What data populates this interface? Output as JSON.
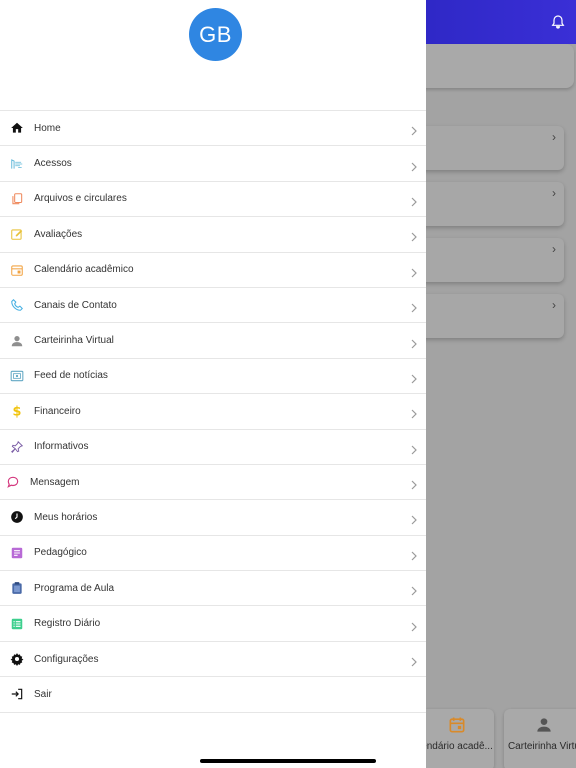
{
  "drawer": {
    "avatar_initials": "GB",
    "avatar_color": "#2f86e2",
    "items": [
      {
        "label": "Home",
        "icon": "home-icon",
        "color": "#111111"
      },
      {
        "label": "Acessos",
        "icon": "access-icon",
        "color": "#5db6d8"
      },
      {
        "label": "Arquivos e circulares",
        "icon": "files-icon",
        "color": "#ef8a5e"
      },
      {
        "label": "Avaliações",
        "icon": "edit-icon",
        "color": "#e8c23a"
      },
      {
        "label": "Calendário acadêmico",
        "icon": "calendar-icon",
        "color": "#f2a444"
      },
      {
        "label": "Canais de Contato",
        "icon": "phone-icon",
        "color": "#47b0e2"
      },
      {
        "label": "Carteirinha Virtual",
        "icon": "person-icon",
        "color": "#8f8f8f"
      },
      {
        "label": "Feed de notícias",
        "icon": "news-icon",
        "color": "#62a8c4"
      },
      {
        "label": "Financeiro",
        "icon": "dollar-icon",
        "color": "#f1c40f"
      },
      {
        "label": "Informativos",
        "icon": "pin-icon",
        "color": "#7b5ea6"
      },
      {
        "label": "Mensagem",
        "icon": "chat-icon",
        "color": "#d4387e"
      },
      {
        "label": "Meus horários",
        "icon": "clock-icon",
        "color": "#111111"
      },
      {
        "label": "Pedagógico",
        "icon": "document-icon",
        "color": "#b86ad6"
      },
      {
        "label": "Programa de Aula",
        "icon": "clipboard-icon",
        "color": "#4a6aa8"
      },
      {
        "label": "Registro Diário",
        "icon": "list-icon",
        "color": "#3ecf8e"
      },
      {
        "label": "Configurações",
        "icon": "gear-icon",
        "color": "#111111"
      },
      {
        "label": "Sair",
        "icon": "logout-icon",
        "color": "#111111"
      }
    ]
  },
  "background": {
    "tiles": [
      {
        "label": "endário acadê...",
        "icon": "calendar-icon",
        "color": "#d98a2a"
      },
      {
        "label": "Carteirinha Virtu",
        "icon": "person-icon",
        "color": "#555555"
      }
    ]
  }
}
